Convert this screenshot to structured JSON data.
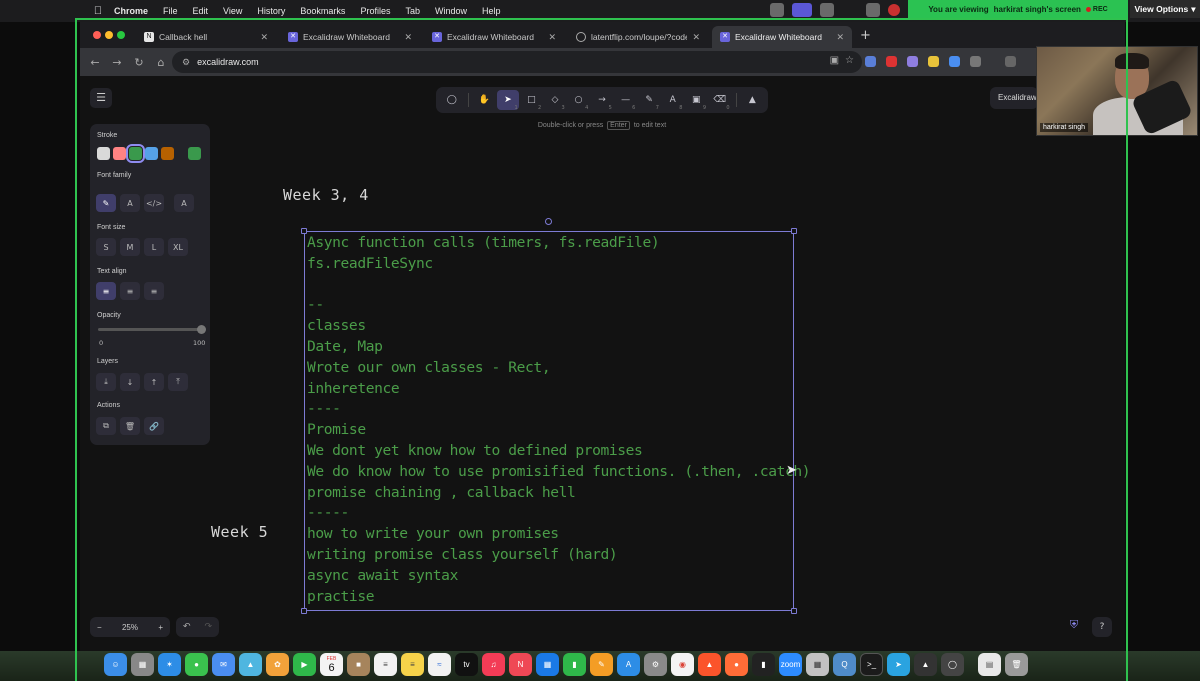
{
  "menubar": {
    "app_name": "Chrome",
    "items": [
      "File",
      "Edit",
      "View",
      "History",
      "Bookmarks",
      "Profiles",
      "Tab",
      "Window",
      "Help"
    ]
  },
  "zoom": {
    "banner_prefix": "You are viewing",
    "banner_name": "harkirat singh's screen",
    "rec": "REC",
    "view_options": "View Options"
  },
  "browser": {
    "tabs": [
      {
        "title": "Callback hell",
        "favicon": "doc-icon"
      },
      {
        "title": "Excalidraw Whiteboard",
        "favicon": "excalidraw-icon"
      },
      {
        "title": "Excalidraw Whiteboard",
        "favicon": "excalidraw-icon"
      },
      {
        "title": "latentflip.com/loupe/?code=C",
        "favicon": "globe-icon"
      },
      {
        "title": "Excalidraw Whiteboard",
        "favicon": "excalidraw-icon"
      }
    ],
    "active_tab": 4,
    "url": "excalidraw.com"
  },
  "excalidraw": {
    "hint_pre": "Double-click or press",
    "hint_key": "Enter",
    "hint_post": "to edit text",
    "library_button": "Excalidraw",
    "props": {
      "stroke": "Stroke",
      "font_family": "Font family",
      "font_size": "Font size",
      "text_align": "Text align",
      "opacity": "Opacity",
      "opacity_min": "0",
      "opacity_max": "100",
      "opacity_value": 100,
      "layers": "Layers",
      "actions": "Actions",
      "sizes": [
        "S",
        "M",
        "L",
        "XL"
      ],
      "stroke_colors": [
        "#d9d9d9",
        "#ff8383",
        "#3a994c",
        "#56a2e8",
        "#b76100",
        "#3a994c"
      ]
    },
    "zoom_level": "25%",
    "canvas": {
      "week34": "Week 3, 4",
      "week5": "Week 5",
      "notes": [
        "Async function calls (timers, fs.readFile)",
        "fs.readFileSync",
        "",
        "--",
        "classes",
        "Date, Map",
        "Wrote our own classes - Rect,",
        "inheretence",
        "----",
        "Promise",
        "We dont yet know how to defined promises",
        "We do know how to use promisified functions. (.then, .catch)",
        "promise chaining , callback hell",
        "-----",
        "how to write your own promises",
        "writing promise class yourself (hard)",
        "async await syntax",
        "practise"
      ]
    }
  },
  "webcam": {
    "name": "harkirat singh"
  },
  "dock": {
    "calendar_month": "FEB",
    "calendar_day": "6",
    "tv_label": "tv",
    "zoom_label": "zoom"
  },
  "colors": {
    "accent": "#6965db",
    "handwriting": "#4b9d49",
    "share_frame": "#2fc24f"
  }
}
